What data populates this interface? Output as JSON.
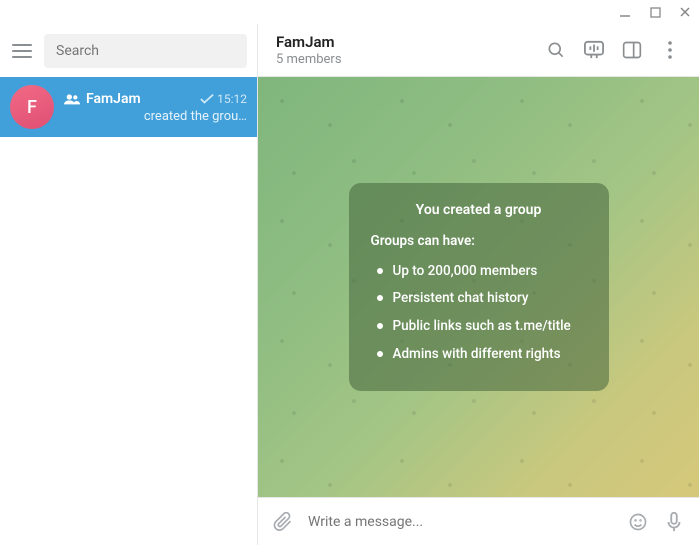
{
  "sidebar": {
    "search_placeholder": "Search",
    "chat": {
      "avatar_letter": "F",
      "name": "FamJam",
      "time": "15:12",
      "preview": "created the grou…"
    }
  },
  "header": {
    "title": "FamJam",
    "subtitle": "5 members"
  },
  "bubble": {
    "title": "You created a group",
    "subtitle": "Groups can have:",
    "items": [
      "Up to 200,000 members",
      "Persistent chat history",
      "Public links such as t.me/title",
      "Admins with different rights"
    ]
  },
  "composer": {
    "placeholder": "Write a message..."
  }
}
